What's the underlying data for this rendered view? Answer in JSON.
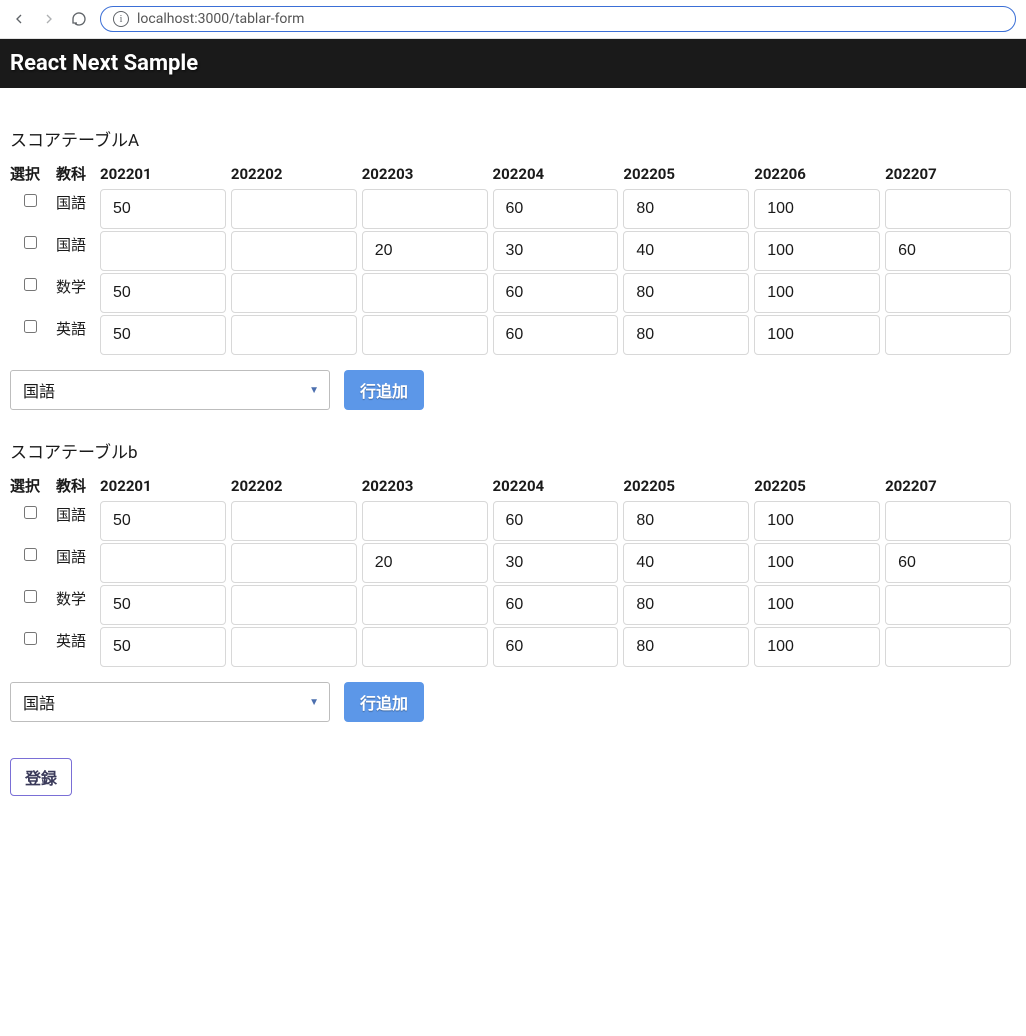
{
  "browser": {
    "url": "localhost:3000/tablar-form"
  },
  "header": {
    "title": "React Next Sample"
  },
  "columns": {
    "select": "選択",
    "subject": "教科"
  },
  "tableA": {
    "title": "スコアテーブルA",
    "months": [
      "202201",
      "202202",
      "202203",
      "202204",
      "202205",
      "202206",
      "202207"
    ],
    "rows": [
      {
        "subject": "国語",
        "scores": [
          "50",
          "",
          "",
          "60",
          "80",
          "100",
          ""
        ]
      },
      {
        "subject": "国語",
        "scores": [
          "",
          "",
          "20",
          "30",
          "40",
          "100",
          "60"
        ]
      },
      {
        "subject": "数学",
        "scores": [
          "50",
          "",
          "",
          "60",
          "80",
          "100",
          ""
        ]
      },
      {
        "subject": "英語",
        "scores": [
          "50",
          "",
          "",
          "60",
          "80",
          "100",
          ""
        ]
      }
    ],
    "select_value": "国語",
    "add_row_label": "行追加"
  },
  "tableB": {
    "title": "スコアテーブルb",
    "months": [
      "202201",
      "202202",
      "202203",
      "202204",
      "202205",
      "202205",
      "202207"
    ],
    "rows": [
      {
        "subject": "国語",
        "scores": [
          "50",
          "",
          "",
          "60",
          "80",
          "100",
          ""
        ]
      },
      {
        "subject": "国語",
        "scores": [
          "",
          "",
          "20",
          "30",
          "40",
          "100",
          "60"
        ]
      },
      {
        "subject": "数学",
        "scores": [
          "50",
          "",
          "",
          "60",
          "80",
          "100",
          ""
        ]
      },
      {
        "subject": "英語",
        "scores": [
          "50",
          "",
          "",
          "60",
          "80",
          "100",
          ""
        ]
      }
    ],
    "select_value": "国語",
    "add_row_label": "行追加"
  },
  "submit_label": "登録"
}
